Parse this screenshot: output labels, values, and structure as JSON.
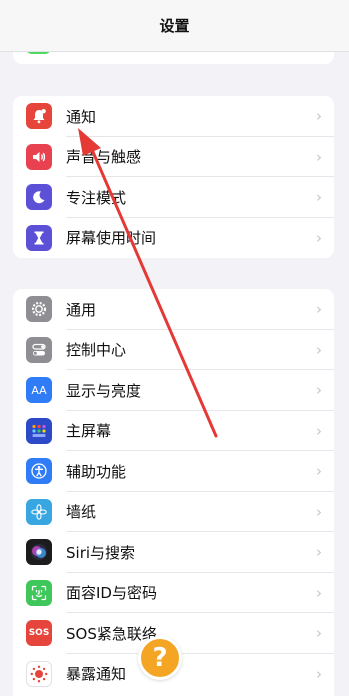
{
  "nav": {
    "title": "设置"
  },
  "group_a": [
    {
      "label": "通知",
      "icon": "bell-badge-icon",
      "color": "#e5453b"
    },
    {
      "label": "声音与触感",
      "icon": "speaker-icon",
      "color": "#e8414f"
    },
    {
      "label": "专注模式",
      "icon": "moon-icon",
      "color": "#5b50d6"
    },
    {
      "label": "屏幕使用时间",
      "icon": "hourglass-icon",
      "color": "#5b50d6"
    }
  ],
  "group_b": [
    {
      "label": "通用",
      "icon": "gear-icon",
      "color": "#8e8e93"
    },
    {
      "label": "控制中心",
      "icon": "toggles-icon",
      "color": "#8e8e93"
    },
    {
      "label": "显示与亮度",
      "icon": "text-size-icon",
      "color": "#2f7cf6"
    },
    {
      "label": "主屏幕",
      "icon": "home-screen-grid-icon",
      "color": "#2c4ac8"
    },
    {
      "label": "辅助功能",
      "icon": "accessibility-icon",
      "color": "#2f7cf6"
    },
    {
      "label": "墙纸",
      "icon": "flower-icon",
      "color": "#38a6e0"
    },
    {
      "label": "Siri与搜索",
      "icon": "siri-icon",
      "color": "#1c1c1e"
    },
    {
      "label": "面容ID与密码",
      "icon": "face-id-icon",
      "color": "#3fc75b"
    },
    {
      "label": "SOS紧急联络",
      "icon": "sos-icon",
      "color": "#e5453b"
    },
    {
      "label": "暴露通知",
      "icon": "exposure-icon",
      "color": "#ffffff"
    }
  ],
  "icons": {
    "text_size": "AA",
    "sos": "SOS",
    "help": "?"
  },
  "colors": {
    "background": "#f2f2f7",
    "arrow": "#e53935",
    "help_badge": "#f5a524"
  }
}
